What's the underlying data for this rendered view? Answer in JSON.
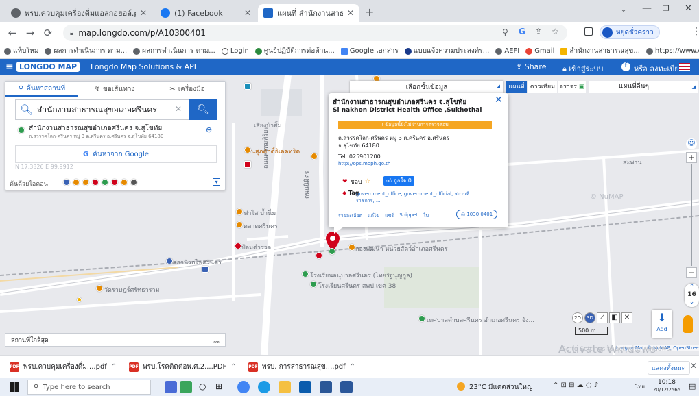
{
  "browser": {
    "tabs": [
      {
        "title": "พรบ.ควบคุมเครื่องดื่มแอลกอฮอล์.pdf",
        "favicon": "globe-icon",
        "active": false
      },
      {
        "title": "(1) Facebook",
        "favicon": "facebook-icon",
        "active": false
      },
      {
        "title": "แผนที่ สำนักงานสาธารณสุขอำเภอศรีนคร",
        "favicon": "longdo-icon",
        "active": true
      }
    ],
    "url": "map.longdo.com/p/A10300401",
    "profile_label": "หยุดชั่วคราว",
    "bookmarks": [
      "แท็บใหม่",
      "ผลการดำเนินการ ตาม...",
      "ผลการดำเนินการ ตาม...",
      "Login",
      "ศูนย์ปฏิบัติการต่อต้าน...",
      "Google เอกสาร",
      "แบบแจ้งความประสงค์ร...",
      "AEFI",
      "Gmail",
      "สำนักงานสาธารณสุข...",
      "https://www.chiang..."
    ],
    "more": "»"
  },
  "longdo": {
    "logo": "LONGDO MAP",
    "title": "Longdo Map Solutions & API",
    "share": "Share",
    "login": "เข้าสู่ระบบ",
    "register": "หรือ ลงทะเบียน"
  },
  "layers": {
    "select_label": "เลือกชั้นข้อมูล",
    "map_types": [
      "แผนที่",
      "ดาวเทียม",
      "จราจร"
    ],
    "other_maps": "แผนที่อื่นๆ"
  },
  "panel": {
    "tabs": [
      "ค้นหาสถานที่",
      "ขอเส้นทาง",
      "เครื่องมือ"
    ],
    "search_value": "สำนักงานสาธารณสุขอเภอศรีนคร",
    "result_name": "สำนักงานสาธารณสุขอำเภอศรีนคร จ.สุโขทัย",
    "result_addr": "ถ.สวรรคโลก-ศรีนคร หมู่ 3 ต.ศรีนคร อ.ศรีนคร จ.สุโขทัย 64180",
    "google_button": "ค้นหาจาก Google",
    "category_label": "ค้นด้วยไอคอน",
    "coords": "N 17.3326  E 99.9912"
  },
  "popup": {
    "title_th": "สำนักงานสาธารณสุขอำเภอศรีนคร จ.สุโขทัย",
    "title_en": "Si nakhon District Health Office ,Sukhothai",
    "warning": "! ข้อมูลนี้ยังไม่ผ่านการตรวจสอบ",
    "address": "ถ.สวรรคโลก-ศรีนคร หมู่ 3 ต.ศรีนคร อ.ศรีนคร จ.สุโขทัย 64180",
    "tel": "Tel: 025901200",
    "url": "http://ops.moph.go.th",
    "like": "ชอบ",
    "share_btn": "ถูกใจ 0",
    "tag_label": "Tag",
    "tags": "government_office, government_official, สถานที่ราชการ, ...",
    "links": [
      "รายละเอียด",
      "แก้ไข",
      "แชร์",
      "Snippet",
      "ไป"
    ],
    "code": "1030 0401"
  },
  "map_labels": [
    "เสียงบ้าสิ้ม",
    "ร้านสุภศักดิ์อิเลคทริค",
    "ฟาไส บ้ำนิ่ม",
    "ตลาดศรีนคร",
    "ป้อมตำรวจ",
    "สถานีรถไฟศรีนคร",
    "กองพัฒนา หน่วยสัตว์อำเภอศรีนคร",
    "โรงเรียนอนุบาลศรีนคร (ไทยรัฐนุญกูล)",
    "โรงเรียนศรีนคร สพป.เขต 38",
    "วัดราษฎร์ศรัทธาราม",
    "เทศบาลตำบลศรีนคร อำเภอศรีนคร จัง...",
    "ถนนพรหมพิริยะ",
    "ถนนนิมิตร",
    "สะพาน",
    "© NuMAP",
    "500 m",
    "Add"
  ],
  "bottom_panel": "สถานที่ใกล้สุด",
  "attribution": "Longdo Map © NuMAP, OpenStreetMap, Ter",
  "activate": {
    "title": "Activate Windows",
    "sub": "Go to Settings to activate Windows."
  },
  "downloads": [
    {
      "name": "พรบ.ควบคุมเครื่องดื่ม....pdf"
    },
    {
      "name": "พรบ.โรคติดต่อพ.ศ.2....PDF"
    },
    {
      "name": "พรบ. การสาธารณสุข....pdf"
    }
  ],
  "show_all": "แสดงทั้งหมด",
  "taskbar": {
    "search_placeholder": "Type here to search",
    "weather": "23°C มีแดดส่วนใหญ่",
    "lang": "ไทย",
    "time": "10:18",
    "date": "20/12/2565"
  },
  "zoom_level": "16",
  "colors": {
    "brand": "#1f67c6",
    "pin": "#d0021b",
    "warning": "#f5a623"
  }
}
